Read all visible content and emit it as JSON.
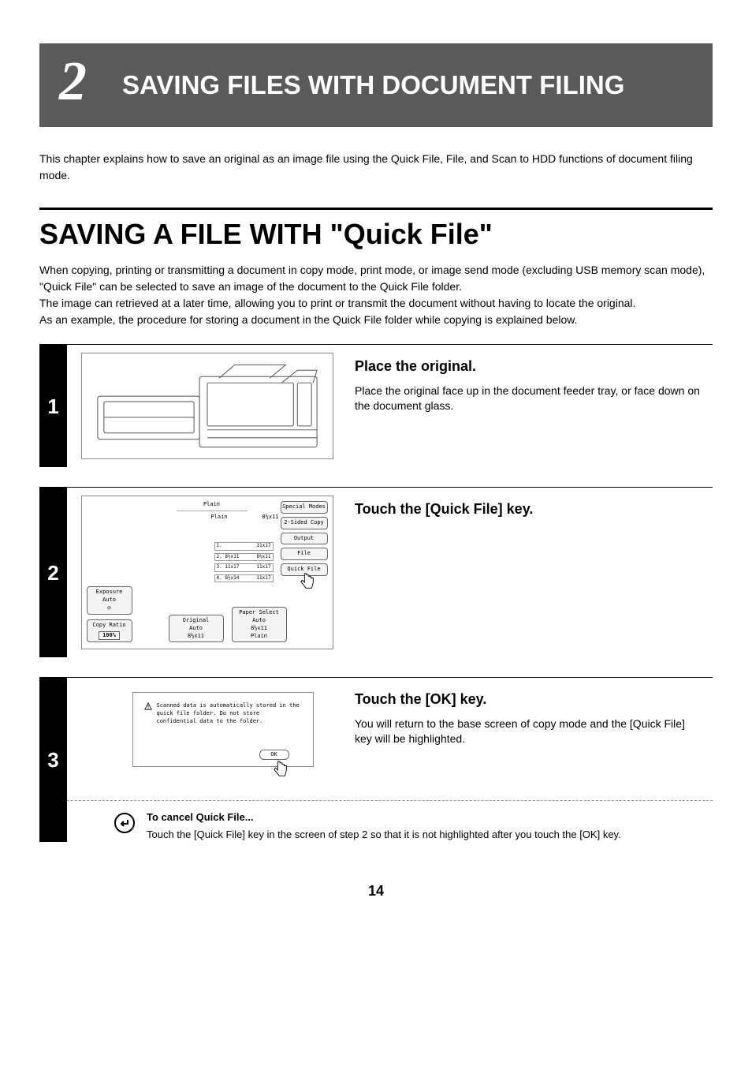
{
  "chapter": {
    "number": "2",
    "title": "SAVING FILES WITH DOCUMENT FILING"
  },
  "intro": "This chapter explains how to save an original as an image file using the Quick File, File, and Scan to HDD functions of document filing mode.",
  "section": {
    "title": "SAVING A FILE WITH \"Quick File\"",
    "body": "When copying, printing or transmitting a document in copy mode, print mode, or image send mode (excluding USB memory scan mode), \"Quick File\" can be selected to save an image of the document to the Quick File folder.\nThe image can retrieved at a later time, allowing you to print or transmit the document without having to locate the original.\nAs an example, the procedure for storing a document in the Quick File folder while copying is explained below."
  },
  "steps": [
    {
      "num": "1",
      "heading": "Place the original.",
      "desc": "Place the original face up in the document feeder tray, or face down on the document glass."
    },
    {
      "num": "2",
      "heading": "Touch the [Quick File] key.",
      "desc": ""
    },
    {
      "num": "3",
      "heading": "Touch the [OK] key.",
      "desc": "You will return to the base screen of copy mode and the [Quick File] key will be highlighted."
    }
  ],
  "screen2": {
    "right_buttons": [
      "Special Modes",
      "2-Sided Copy",
      "Output",
      "File",
      "Quick File"
    ],
    "exposure_label": "Exposure",
    "auto_label": "Auto",
    "copy_ratio_label": "Copy Ratio",
    "copy_ratio_value": "100%",
    "original_label": "Original",
    "original_value": "Auto",
    "original_size": "8½x11",
    "paper_label": "Paper Select",
    "paper_value": "Auto",
    "paper_size": "8½x11",
    "paper_type": "Plain",
    "plain_top": "Plain",
    "plain2_label": "Plain",
    "plain2_size": "8½x11",
    "trays": [
      {
        "left": "1.",
        "right": "11x17"
      },
      {
        "left": "2. 8½x11",
        "right": "8½x11"
      },
      {
        "left": "3. 11x17",
        "right": "11x17"
      },
      {
        "left": "4. 8½x14",
        "right": "11x17"
      }
    ]
  },
  "screen3": {
    "warning": "Scanned data is automatically stored in the quick file folder. Do not store confidential data to the folder.",
    "ok_label": "OK"
  },
  "note": {
    "title": "To cancel Quick File...",
    "body": "Touch the [Quick File] key in the screen of step 2 so that it is not highlighted after you touch the [OK] key."
  },
  "page_number": "14"
}
